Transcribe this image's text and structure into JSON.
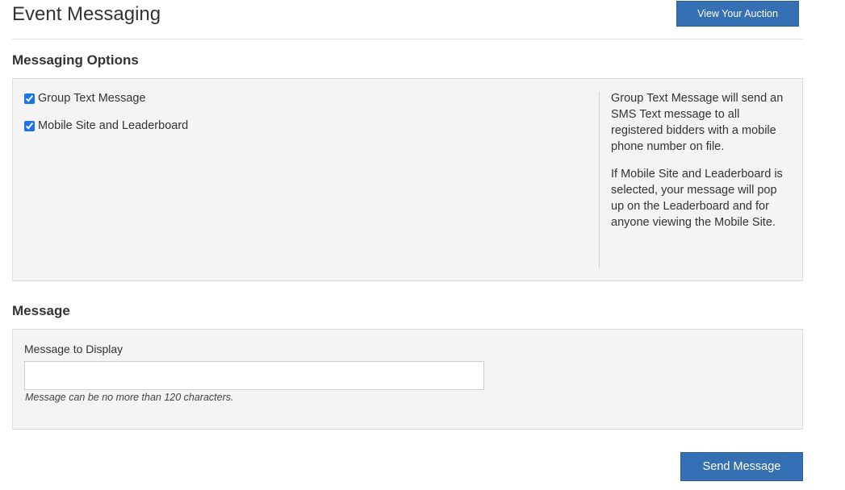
{
  "header": {
    "title": "Event Messaging",
    "view_auction_label": "View Your Auction"
  },
  "messaging_options": {
    "heading": "Messaging Options",
    "options": [
      {
        "label": "Group Text Message",
        "checked": true
      },
      {
        "label": "Mobile Site and Leaderboard",
        "checked": true
      }
    ],
    "help": [
      "Group Text Message will send an SMS Text message to all registered bidders with a mobile phone number on file.",
      "If Mobile Site and Leaderboard is selected, your message will pop up on the Leaderboard and for anyone viewing the Mobile Site."
    ]
  },
  "message": {
    "heading": "Message",
    "field_label": "Message to Display",
    "value": "",
    "placeholder": "",
    "hint": "Message can be no more than 120 characters."
  },
  "actions": {
    "send_label": "Send Message"
  },
  "colors": {
    "primary_button": "#3470b3",
    "panel_background": "#f4f4f4"
  }
}
